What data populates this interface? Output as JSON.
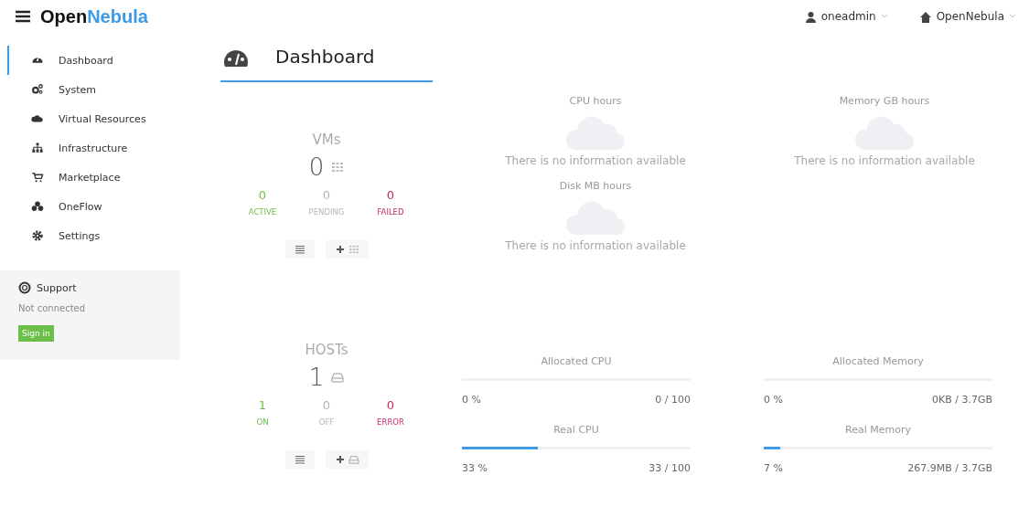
{
  "header": {
    "logo": {
      "first": "Open",
      "second": "Nebula"
    },
    "user": "oneadmin",
    "zone": "OpenNebula"
  },
  "sidebar": {
    "items": [
      {
        "label": "Dashboard",
        "kind": "dashboard",
        "selected": true
      },
      {
        "label": "System",
        "kind": "system",
        "selected": false
      },
      {
        "label": "Virtual Resources",
        "kind": "cloud",
        "selected": false
      },
      {
        "label": "Infrastructure",
        "kind": "infrastructure",
        "selected": false
      },
      {
        "label": "Marketplace",
        "kind": "cart",
        "selected": false
      },
      {
        "label": "OneFlow",
        "kind": "flow",
        "selected": false
      },
      {
        "label": "Settings",
        "kind": "settings",
        "selected": false
      }
    ],
    "support": {
      "title": "Support",
      "status": "Not connected",
      "button": "Sign in"
    }
  },
  "page_title": "Dashboard",
  "widgets": [
    {
      "title": "VMs",
      "count": "0",
      "kind": "vm",
      "states": [
        {
          "value": "0",
          "label": "ACTIVE",
          "color": "#6cc04a"
        },
        {
          "value": "0",
          "label": "PENDING",
          "color": "#b5b5b5"
        },
        {
          "value": "0",
          "label": "FAILED",
          "color": "#c7286d"
        }
      ]
    },
    {
      "title": "HOSTs",
      "count": "1",
      "kind": "host",
      "states": [
        {
          "value": "1",
          "label": "ON",
          "color": "#6cc04a"
        },
        {
          "value": "0",
          "label": "OFF",
          "color": "#b5b5b5"
        },
        {
          "value": "0",
          "label": "ERROR",
          "color": "#c7286d"
        }
      ]
    }
  ],
  "accounting": [
    {
      "title": "CPU hours",
      "message": "There is no information available"
    },
    {
      "title": "Memory GB hours",
      "message": "There is no information available"
    },
    {
      "title": "Disk MB hours",
      "message": "There is no information available"
    }
  ],
  "meters": [
    {
      "title": "Allocated CPU",
      "level": 0,
      "percent": "0 %",
      "reading": "0 / 100"
    },
    {
      "title": "Allocated Memory",
      "level": 0,
      "percent": "0 %",
      "reading": "0KB / 3.7GB"
    },
    {
      "title": "Real CPU",
      "level": 0.33,
      "percent": "33 %",
      "reading": "33 / 100"
    },
    {
      "title": "Real Memory",
      "level": 0.07,
      "percent": "7 %",
      "reading": "267.9MB / 3.7GB"
    }
  ]
}
